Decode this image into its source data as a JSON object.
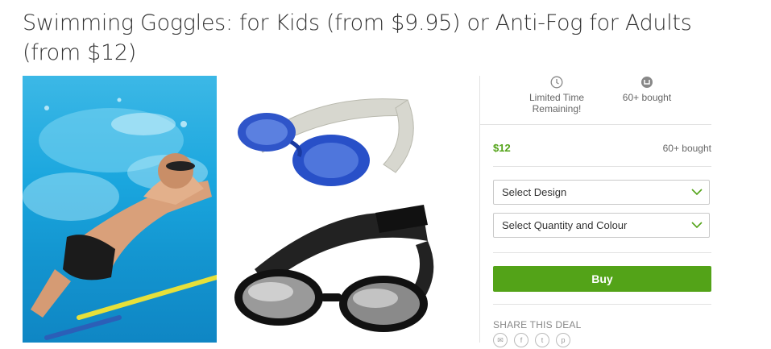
{
  "deal": {
    "title": "Swimming Goggles: for Kids (from $9.95) or Anti-Fog for Adults (from $12)"
  },
  "stats": {
    "limited_time": "Limited Time Remaining!",
    "bought_count": "60+ bought"
  },
  "pricing": {
    "price": "$12",
    "bought": "60+ bought"
  },
  "options": {
    "design_placeholder": "Select Design",
    "quantity_placeholder": "Select Quantity and Colour"
  },
  "actions": {
    "buy_label": "Buy"
  },
  "share": {
    "label": "SHARE THIS DEAL",
    "icons": [
      "email-icon",
      "facebook-icon",
      "twitter-icon",
      "pinterest-icon"
    ]
  },
  "colors": {
    "accent_green": "#53a318",
    "goggle_blue": "#2850c8",
    "water_blue": "#1aa6de"
  }
}
